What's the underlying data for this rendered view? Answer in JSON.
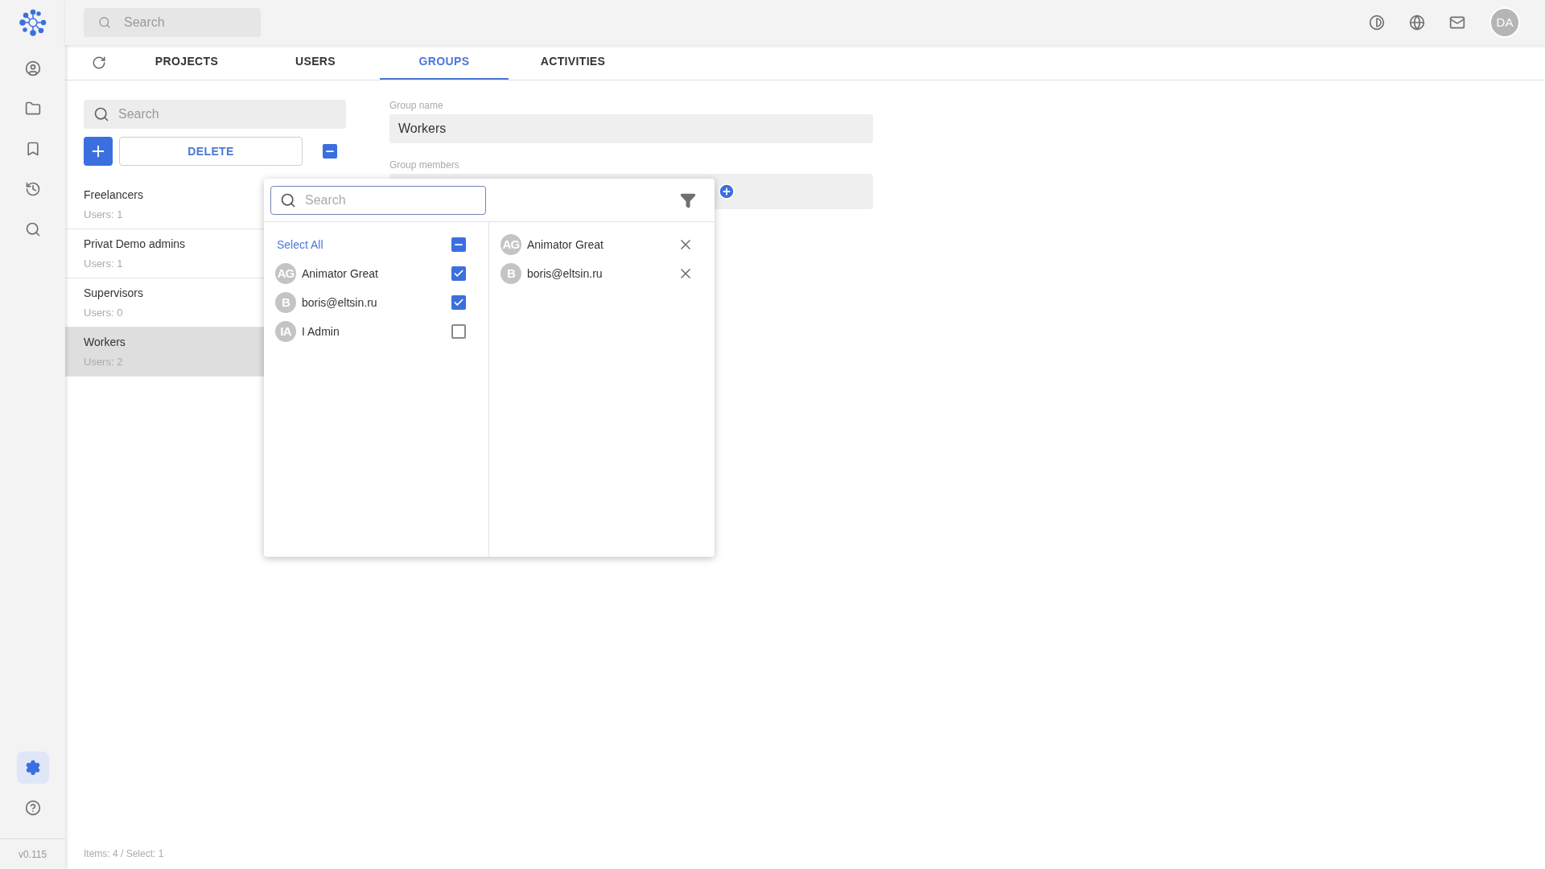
{
  "sidebar": {
    "items": [
      {
        "kind": "account",
        "selected": false
      },
      {
        "kind": "folder",
        "selected": false
      },
      {
        "kind": "bookmark",
        "selected": false
      },
      {
        "kind": "history",
        "selected": false
      },
      {
        "kind": "search",
        "selected": false
      }
    ],
    "bottom_items": [
      {
        "kind": "settings",
        "selected": true
      },
      {
        "kind": "help",
        "selected": false
      }
    ],
    "version": "v0.115"
  },
  "top_bar": {
    "search_placeholder": "Search",
    "avatar": "DA"
  },
  "tabs": [
    {
      "label": "PROJECTS",
      "selected": false
    },
    {
      "label": "USERS",
      "selected": false
    },
    {
      "label": "GROUPS",
      "selected": true
    },
    {
      "label": "ACTIVITIES",
      "selected": false
    }
  ],
  "groups_panel": {
    "search_placeholder": "Search",
    "delete_label": "DELETE",
    "bulk_select": {
      "indeterminate": true
    },
    "groups": [
      {
        "name": "Freelancers",
        "users": "Users: 1",
        "selected": false
      },
      {
        "name": "Privat Demo admins",
        "users": "Users: 1",
        "selected": false
      },
      {
        "name": "Supervisors",
        "users": "Users: 0",
        "selected": false
      },
      {
        "name": "Workers",
        "users": "Users: 2",
        "selected": true
      }
    ]
  },
  "form": {
    "group_name_label": "Group name",
    "group_name_value": "Workers",
    "members_label": "Group members"
  },
  "picker": {
    "search_placeholder": "Search",
    "select_all_label": "Select All",
    "select_all": {
      "indeterminate": true
    },
    "users": [
      {
        "initials": "AG",
        "name": "Animator Great",
        "checked": true
      },
      {
        "initials": "B",
        "name": "boris@eltsin.ru",
        "checked": true
      },
      {
        "initials": "IA",
        "name": "I Admin",
        "checked": false
      }
    ],
    "chosen": [
      {
        "initials": "AG",
        "name": "Animator Great"
      },
      {
        "initials": "B",
        "name": "boris@eltsin.ru"
      }
    ]
  },
  "status_bar": "Items: 4 / Select: 1"
}
